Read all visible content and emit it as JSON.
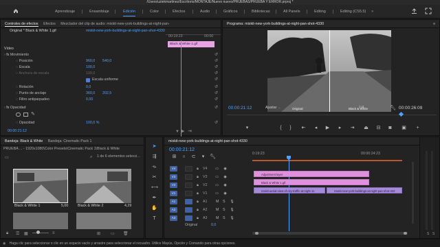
{
  "window": {
    "title": "/Users/uziekmartinez/Escritorio/MONTAJE/Nuevo nuevo/PRUEBAS/PRUEBA Y ERROR.prproj *"
  },
  "workspaces": {
    "tabs": [
      "Aprendizaje",
      "Ensamblaje",
      "Edición",
      "Color",
      "Efectos",
      "Audio",
      "Gráficos",
      "Bibliotecas",
      "All Panels",
      "Editing",
      "Editing (CS5.5)"
    ],
    "active": "Edición"
  },
  "effects_panel": {
    "tabs": [
      "Controles de efectos",
      "Efectos",
      "Mezclador del clip de audio: mixkit-new-york-buildings-at-night-pan-"
    ],
    "source_label": "Original * Black & White 1.gif",
    "sequence_label": "mixkit-new-york-buildings-at-night-pan-shot-4330",
    "timecode_start": "00:19:23",
    "timecode_end": "00:00",
    "clip_label": "Black & White 1.gif",
    "section_video": "Vídeo",
    "motion": {
      "label": "Movimiento",
      "position_label": "Posición",
      "position_x": "960,0",
      "position_y": "540,0",
      "scale_label": "Escala",
      "scale_value": "100,0",
      "scale_width_label": "Anchura de escala",
      "scale_width_value": "100,0",
      "uniform_label": "Escala uniforme",
      "rotation_label": "Rotación",
      "rotation_value": "0,0",
      "anchor_label": "Punto de anclaje",
      "anchor_x": "360,0",
      "anchor_y": "202,5",
      "flicker_label": "Filtro antiparpadeo",
      "flicker_value": "0,00"
    },
    "opacity": {
      "label": "Opacidad",
      "value_label": "Opacidad",
      "value": "100,0 %"
    },
    "timecode_bottom": "00:00:21:12"
  },
  "program_monitor": {
    "title": "Programa: mixkit-new-york-buildings-at-night-pan-shot-4330",
    "menu_icon": "hamburger-icon",
    "split_left_label": "Original",
    "split_right_label": "Black & White",
    "current_time": "00:00:21:12",
    "fit_label": "Ajustar",
    "quality": "1/4",
    "duration": "00:00:26:09"
  },
  "project_panel": {
    "tabs": [
      "Bandeja: Black & White",
      "Bandeja: Cinematic Pack 1"
    ],
    "path": "PRUEBA ... - 1920x1080\\Color Presets\\Cinematic Pack 1\\Black & White",
    "count": "1 de 6 elementos selecci...",
    "items": [
      {
        "name": "Black & White 1",
        "duration": "5,00"
      },
      {
        "name": "Black & White 2",
        "duration": "4,29"
      }
    ]
  },
  "timeline": {
    "title": "mixkit-new-york-buildings-at-night-pan-shot-4330",
    "timecode": "00:00:21:12",
    "ruler_left": "0:19:23",
    "ruler_right": "00:00:24:23",
    "tracks": [
      {
        "src": "V4",
        "name": "V4"
      },
      {
        "src": "V3",
        "name": "V3"
      },
      {
        "src": "V2",
        "name": "V2"
      },
      {
        "src": "V1",
        "name": "V1"
      },
      {
        "src": "A1",
        "name": "A1",
        "m": "M",
        "s": "S"
      },
      {
        "src": "A2",
        "name": "A2",
        "m": "M",
        "s": "S"
      },
      {
        "src": "A3",
        "name": "A3",
        "m": "M",
        "s": "S"
      }
    ],
    "master_label": "Original",
    "master_value": "0,0",
    "clips": {
      "adjustment": "Adjustment layer",
      "bw": "Black & White 1.gif",
      "v1_a": "mixkit-aerial-view-of-city-traffic-at-night-11",
      "v1_b": "mixkit-new-york-buildings-at-night-pan-shot-433"
    }
  },
  "status": {
    "text": "Haga clic para seleccionar o clic en un espacio vacío y arrastre para seleccionar el recuadro. Utilice Mayús, Opción y Comando para otras opciones."
  },
  "colors": {
    "accent": "#4da3ff",
    "clip_pink": "#e091dd",
    "clip_violet": "#a68ad9",
    "playhead": "#4da3ff"
  }
}
